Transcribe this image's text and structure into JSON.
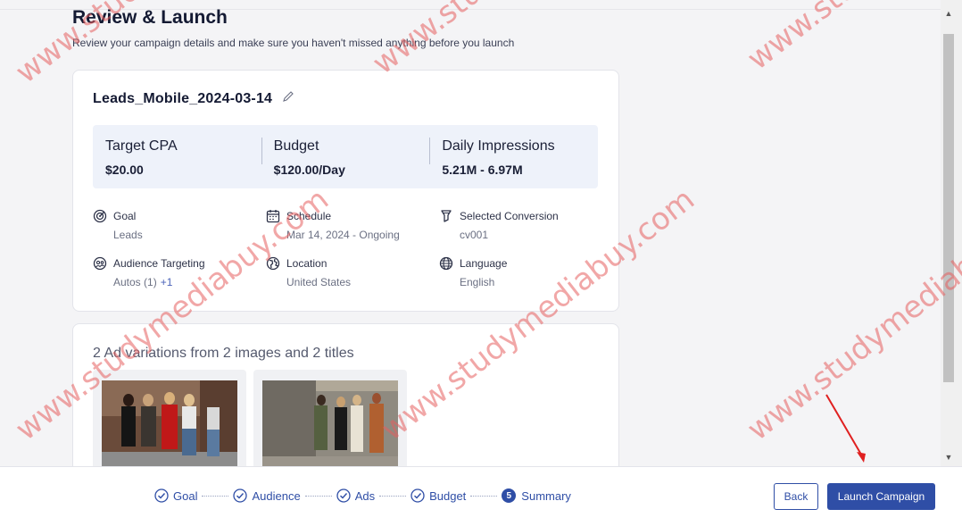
{
  "page": {
    "title": "Review & Launch",
    "subtitle": "Review your campaign details and make sure you haven't missed anything before you launch"
  },
  "campaign": {
    "name": "Leads_Mobile_2024-03-14",
    "metrics": [
      {
        "label": "Target CPA",
        "value": "$20.00"
      },
      {
        "label": "Budget",
        "value": "$120.00/Day"
      },
      {
        "label": "Daily Impressions",
        "value": "5.21M - 6.97M"
      }
    ],
    "details": {
      "goal": {
        "title": "Goal",
        "value": "Leads"
      },
      "schedule": {
        "title": "Schedule",
        "value": "Mar 14, 2024 - Ongoing"
      },
      "conversion": {
        "title": "Selected Conversion",
        "value": "cv001"
      },
      "audience": {
        "title": "Audience Targeting",
        "value": "Autos (1)",
        "extra": "+1"
      },
      "location": {
        "title": "Location",
        "value": "United States"
      },
      "language": {
        "title": "Language",
        "value": "English"
      }
    }
  },
  "ads": {
    "title": "2 Ad variations from 2 images and 2 titles"
  },
  "steps": [
    {
      "label": "Goal",
      "state": "done"
    },
    {
      "label": "Audience",
      "state": "done"
    },
    {
      "label": "Ads",
      "state": "done"
    },
    {
      "label": "Budget",
      "state": "done"
    },
    {
      "label": "Summary",
      "state": "current",
      "number": "5"
    }
  ],
  "buttons": {
    "back": "Back",
    "launch": "Launch Campaign"
  },
  "watermark": {
    "text": "www.studymediabuy.com"
  },
  "colors": {
    "accent": "#2f4ea6",
    "metrics_bg": "#eef2fa",
    "annotation_arrow": "#e02020"
  }
}
